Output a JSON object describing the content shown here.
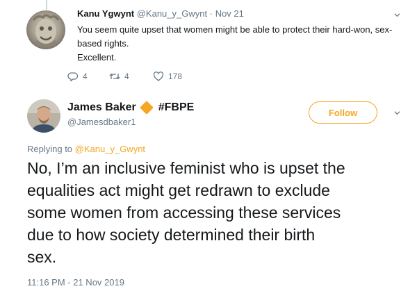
{
  "parent_tweet": {
    "author_name": "Kanu Ygwynt",
    "author_handle": "@Kanu_y_Gwynt",
    "date": "Nov 21",
    "separator": "·",
    "text_lines": [
      "You seem quite upset that women might be able to protect their hard-won, sex-",
      "based rights.",
      "Excellent."
    ],
    "reply_count": "4",
    "retweet_count": "4",
    "like_count": "178"
  },
  "main_tweet": {
    "author_name": "James Baker",
    "name_suffix": "#FBPE",
    "author_handle": "@Jamesdbaker1",
    "follow_label": "Follow",
    "replying_prefix": "Replying to",
    "replying_to": "@Kanu_y_Gwynt",
    "text_lines": [
      "No, I’m an inclusive feminist who is upset the",
      "equalities act might get redrawn to exclude",
      "some women from accessing these services",
      "due to how society determined their birth",
      "sex."
    ],
    "timestamp": "11:16 PM - 21 Nov 2019"
  },
  "icons": [
    "reply-icon",
    "retweet-icon",
    "like-icon",
    "chevron-down-icon",
    "orange-diamond-icon"
  ],
  "colors": {
    "accent": "#f5a623",
    "text": "#14171a",
    "muted": "#657786"
  }
}
